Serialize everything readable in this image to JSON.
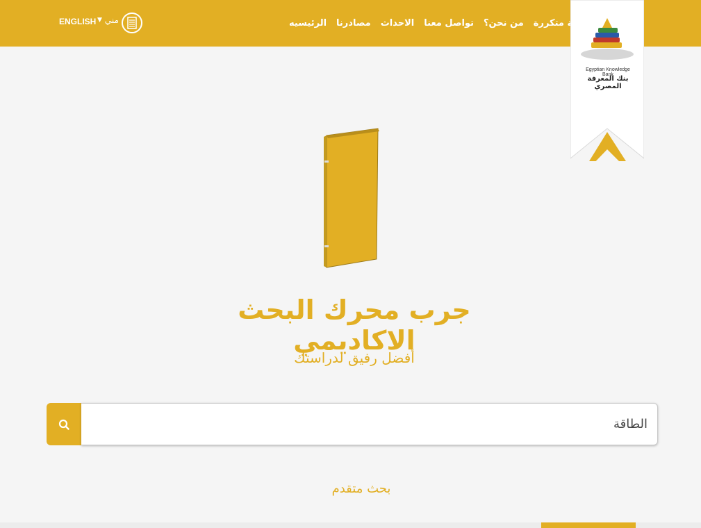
{
  "header": {
    "nav": [
      {
        "label": "الرئيسيه"
      },
      {
        "label": "مصادرنا"
      },
      {
        "label": "الاحداث"
      },
      {
        "label": "تواصل معنا"
      },
      {
        "label": "من نحن؟"
      },
      {
        "label": "أسئلة متكررة"
      }
    ],
    "language_label": "ENGLISH",
    "mine_label": "مني"
  },
  "logo": {
    "name_en": "Egyptian Knowledge Bank",
    "name_ar": "بنك المعرفة المصري"
  },
  "hero": {
    "title": "جرب محرك البحث الاكاديمي",
    "subtitle": "أفضل رفيق لدراستك"
  },
  "search": {
    "value": "الطاقة"
  },
  "advanced_search_label": "بحث متقدم",
  "colors": {
    "accent": "#e2af24",
    "background": "#f5f5f5"
  },
  "icons": {
    "search": "search-icon",
    "library": "library-icon",
    "caret": "chevron-down-icon"
  }
}
